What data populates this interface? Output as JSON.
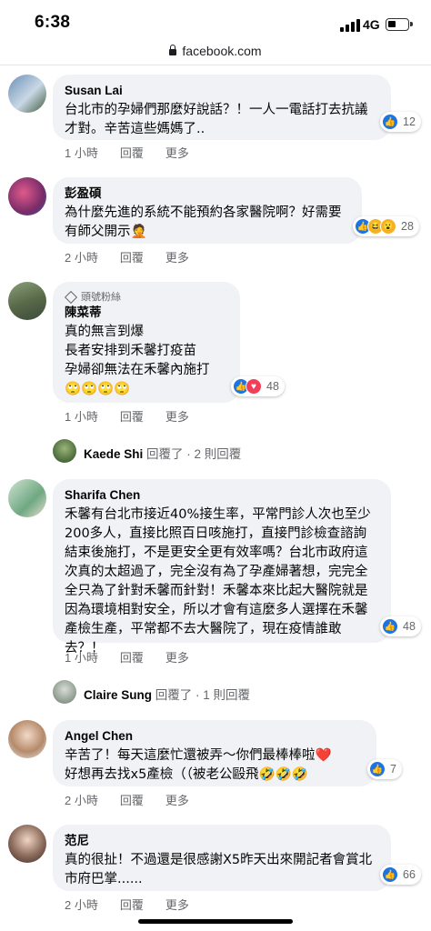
{
  "status_bar": {
    "time": "6:38",
    "network": "4G",
    "battery_icon": "battery-low-icon",
    "signal_icon": "cellular-signal-icon"
  },
  "browser": {
    "url": "facebook.com",
    "lock_icon": "lock-icon"
  },
  "comments": [
    {
      "author": "Susan Lai",
      "badge": "",
      "text": "台北市的孕婦們那麼好說話？！一人一電話打去抗議才對。辛苦這些媽媽了..",
      "time": "1 小時",
      "reply_label": "回覆",
      "more_label": "更多",
      "reaction_count": "12",
      "reactions": [
        "like"
      ]
    },
    {
      "author": "彭盈碩",
      "badge": "",
      "text": "為什麼先進的系統不能預約各家醫院啊？好需要有師父開示🤦",
      "time": "2 小時",
      "reply_label": "回覆",
      "more_label": "更多",
      "reaction_count": "28",
      "reactions": [
        "like",
        "haha",
        "wow"
      ]
    },
    {
      "author": "陳菜蒂",
      "badge": "頭號粉絲",
      "text": "真的無言到爆\n長者安排到禾馨打疫苗\n孕婦卻無法在禾馨內施打\n🙄🙄🙄🙄",
      "time": "1 小時",
      "reply_label": "回覆",
      "more_label": "更多",
      "reaction_count": "48",
      "reactions": [
        "like",
        "love"
      ]
    },
    {
      "author": "Sharifa Chen",
      "badge": "",
      "text": "禾馨有台北市接近40%接生率，平常門診人次也至少200多人，直接比照百日咳施打，直接門診檢查諮詢結束後施打，不是更安全更有效率嗎？台北市政府這次真的太超過了，完全沒有為了孕產婦著想，完完全全只為了針對禾馨而針對！禾馨本來比起大醫院就是因為環境相對安全，所以才會有這麼多人選擇在禾馨產檢生產，平常都不去大醫院了，現在疫情誰敢去？！",
      "time": "1 小時",
      "reply_label": "回覆",
      "more_label": "更多",
      "reaction_count": "48",
      "reactions": [
        "like"
      ]
    },
    {
      "author": "Angel Chen",
      "badge": "",
      "text": "辛苦了！每天這麼忙還被弄～你們最棒棒啦❤️\n好想再去找x5產檢（（被老公毆飛🤣🤣🤣",
      "time": "2 小時",
      "reply_label": "回覆",
      "more_label": "更多",
      "reaction_count": "7",
      "reactions": [
        "like"
      ]
    },
    {
      "author": "范尼",
      "badge": "",
      "text": "真的很扯！不過還是很感謝X5昨天出來開記者會賞北市府巴掌......",
      "time": "2 小時",
      "reply_label": "回覆",
      "more_label": "更多",
      "reaction_count": "66",
      "reactions": [
        "like"
      ]
    }
  ],
  "replies": [
    {
      "name": "Kaede Shi",
      "meta": "回覆了 · 2 則回覆"
    },
    {
      "name": "Claire Sung",
      "meta": "回覆了 · 1 則回覆"
    }
  ],
  "colors": {
    "bubble": "#f0f2f5",
    "meta_text": "#65676b",
    "like_blue": "#1b74e4",
    "love_red": "#f33e58",
    "emoji_yellow": "#f7b125"
  }
}
